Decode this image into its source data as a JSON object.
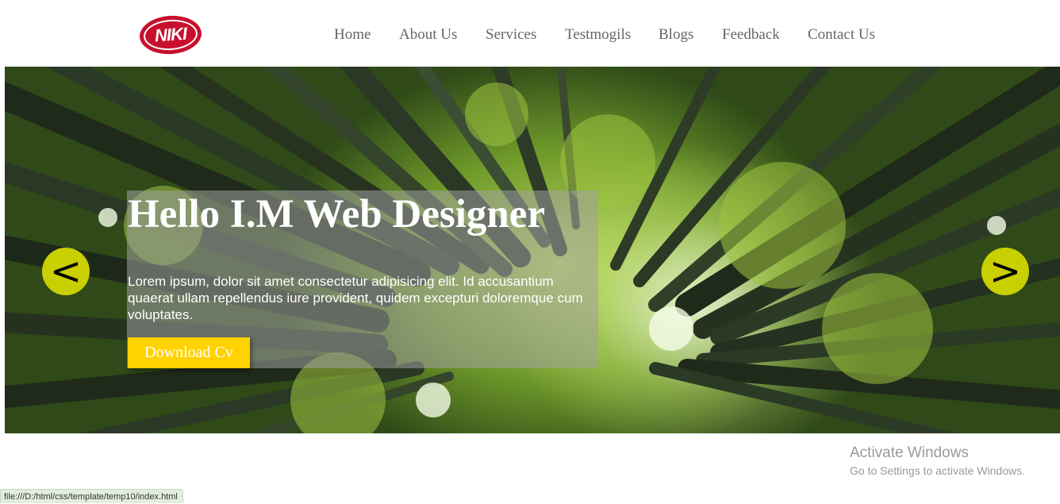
{
  "header": {
    "logo_text": "NIKI",
    "nav": [
      "Home",
      "About Us",
      "Services",
      "Testmogils",
      "Blogs",
      "Feedback",
      "Contact Us"
    ]
  },
  "hero": {
    "title": "Hello I.M Web Designer",
    "text": "Lorem ipsum, dolor sit amet consectetur adipisicing elit. Id accusantium quaerat ullam repellendus iure provident, quidem excepturi doloremque cum voluptates.",
    "button_label": "Download Cv",
    "prev_label": "<",
    "next_label": ">"
  },
  "system": {
    "activate_title": "Activate Windows",
    "activate_subtitle": "Go to Settings to activate Windows.",
    "status_url": "file:///D:/html/css/template/temp10/index.html"
  },
  "colors": {
    "brand": "#c8102e",
    "button": "#ffd200",
    "arrow": "#c9cf00",
    "nav_text": "#666666"
  }
}
